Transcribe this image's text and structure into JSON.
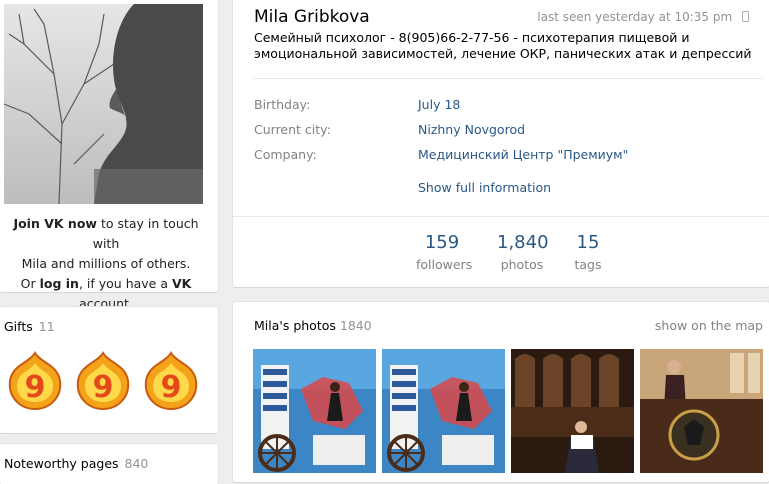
{
  "profile": {
    "name": "Mila Gribkova",
    "last_seen": "last seen yesterday at 10:35 pm",
    "status": "Семейный психолог - 8(905)66-2-77-56 - психотерапия пищевой и эмоциональной зависимостей, лечение ОКР, панических атак и депрессий",
    "info": [
      {
        "label": "Birthday:",
        "value": "July 18"
      },
      {
        "label": "Current city:",
        "value": "Nizhny Novgorod"
      },
      {
        "label": "Company:",
        "value": "Медицинский Центр \"Премиум\""
      }
    ],
    "show_full": "Show full information",
    "counters": [
      {
        "num": "159",
        "label": "followers"
      },
      {
        "num": "1,840",
        "label": "photos"
      },
      {
        "num": "15",
        "label": "tags"
      }
    ]
  },
  "join": {
    "line1_bold": "Join VK now",
    "line1_rest": " to stay in touch with",
    "line2": "Mila and millions of others.",
    "line3_a": "Or ",
    "line3_login": "log in",
    "line3_b": ", if you have a ",
    "line3_vk": "VK",
    "line3_c": " account."
  },
  "gifts": {
    "title": "Gifts",
    "count": "11"
  },
  "noteworthy": {
    "title": "Noteworthy pages",
    "count": "840"
  },
  "photos": {
    "title": "Mila's photos",
    "count": "1840",
    "map_link": "show on the map"
  },
  "colors": {
    "link": "#2a5885",
    "muted": "#828282",
    "background": "#edeef0"
  }
}
